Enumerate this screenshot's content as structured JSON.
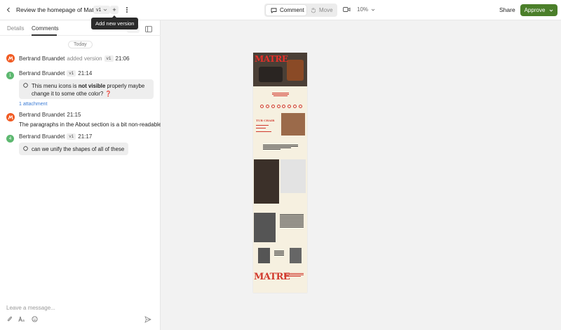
{
  "topbar": {
    "title": "Review the homepage of Matre",
    "version_label": "v1",
    "add_version_label": "+",
    "tooltip": "Add new version",
    "mode_comment": "Comment",
    "mode_move": "Move",
    "zoom": "10%",
    "share": "Share",
    "approve": "Approve"
  },
  "tabs": {
    "details": "Details",
    "comments": "Comments"
  },
  "feed": {
    "date_divider": "Today",
    "items": [
      {
        "author": "Bertrand Bruandet",
        "action": "added version",
        "version": "v1",
        "time": "21:06"
      },
      {
        "author": "Bertrand Bruandet",
        "version": "v1",
        "time": "21:14",
        "number": "1",
        "text_pre": "This menu icons is ",
        "text_bold": "not visible",
        "text_post": " properly maybe",
        "text_line2": "change it to some othe color? ",
        "emoji": "❓",
        "attachment": "1 attachment"
      },
      {
        "author": "Bertrand Bruandet",
        "time": "21:15",
        "text": "The paragraphs in the About section is a bit non-readable"
      },
      {
        "author": "Bertrand Bruandet",
        "version": "v1",
        "time": "21:17",
        "number": "4",
        "text": "can we unify the shapes of all of these"
      }
    ]
  },
  "composer": {
    "placeholder": "Leave a message..."
  },
  "preview": {
    "brand": "MATRE",
    "tub_chair": "TUB CHAIR"
  },
  "colors": {
    "approve": "#4b7f2a",
    "avatar_logo": "#f15a22",
    "pin_green": "#5db870",
    "link": "#3a7bd5"
  }
}
